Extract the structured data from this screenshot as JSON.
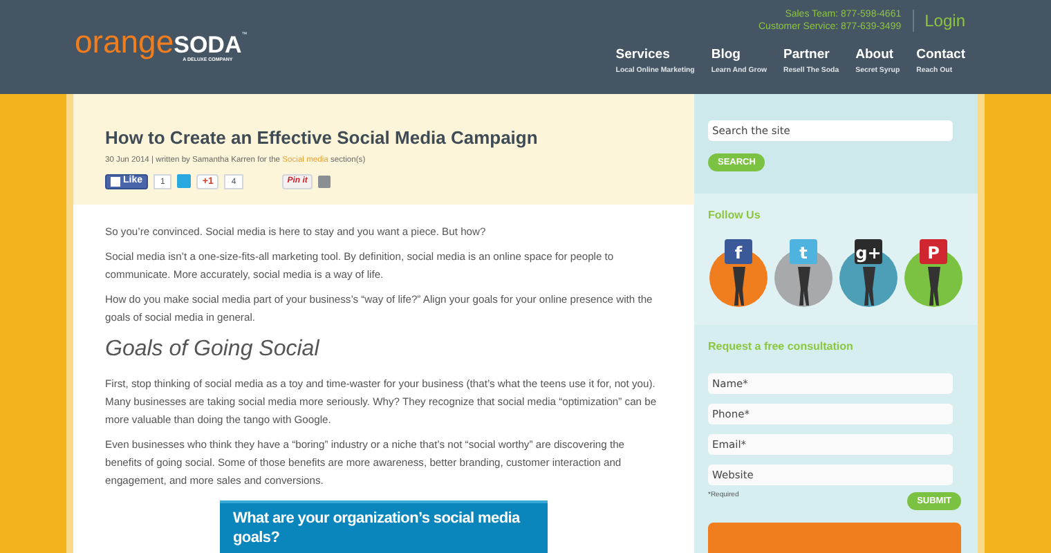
{
  "header": {
    "logo": {
      "word1": "orange",
      "word2": "SODA",
      "tm": "™",
      "tagline": "A DELUXE COMPANY"
    },
    "contacts": [
      "Sales Team: 877-598-4661",
      "Customer Service: 877-639-3499"
    ],
    "login": "Login",
    "nav": [
      {
        "label": "Services",
        "sub": "Local Online Marketing"
      },
      {
        "label": "Blog",
        "sub": "Learn And Grow"
      },
      {
        "label": "Partner",
        "sub": "Resell The Soda"
      },
      {
        "label": "About",
        "sub": "Secret Syrup"
      },
      {
        "label": "Contact",
        "sub": "Reach Out"
      }
    ]
  },
  "article": {
    "title": "How to Create an Effective Social Media Campaign",
    "meta": {
      "before": "30 Jun 2014 | written by Samantha Karren for the",
      "link": "Social media",
      "after": "section(s)"
    },
    "share": [
      {
        "kind": "facebook",
        "label": "Like",
        "count": "1"
      },
      {
        "kind": "twitter"
      },
      {
        "kind": "google",
        "label": "+1",
        "count": "4"
      },
      {
        "kind": "pinterest",
        "label": "Pin it"
      },
      {
        "kind": "email"
      }
    ],
    "blocks": [
      {
        "kind": "p",
        "text": "So you’re convinced. Social media is here to stay and you want a piece. But how?"
      },
      {
        "kind": "p",
        "text": "Social media isn’t a one-size-fits-all marketing tool. By definition, social media is an online space for people to communicate. More accurately, social media is a way of life."
      },
      {
        "kind": "p",
        "text": "How do you make social media part of your business’s “way of life?” Align your goals for your online presence with the goals of social media in general."
      },
      {
        "kind": "h2",
        "text": "Goals of Going Social"
      },
      {
        "kind": "p",
        "text": "First, stop thinking of social media as a toy and time-waster for your business (that’s what the teens use it for, not you). Many businesses are taking social media more seriously. Why? They recognize that social media “optimization” can be more valuable than doing the tango with Google."
      },
      {
        "kind": "p",
        "text": "Even businesses who think they have a “boring” industry or a niche that’s not “social worthy” are discovering the benefits of going social. Some of those benefits are more awareness, better branding, customer interaction and engagement, and more sales and conversions."
      },
      {
        "kind": "banner",
        "text": "What are your organization’s social media goals?"
      }
    ]
  },
  "sidebar": {
    "search": {
      "placeholder": "Search the site",
      "button": "SEARCH"
    },
    "follow": {
      "title": "Follow Us",
      "items": [
        {
          "kind": "facebook",
          "color": "#f07d1e",
          "letter": "f"
        },
        {
          "kind": "twitter",
          "color": "#a7a9ab",
          "letter": "t"
        },
        {
          "kind": "google",
          "color": "#4d9fb8",
          "letter": "g+"
        },
        {
          "kind": "pinterest",
          "color": "#7cc242",
          "letter": "P"
        }
      ]
    },
    "consult": {
      "title": "Request a free consultation",
      "fields": [
        {
          "placeholder": "Name*"
        },
        {
          "placeholder": "Phone*"
        },
        {
          "placeholder": "Email*"
        },
        {
          "placeholder": "Website"
        }
      ],
      "note": "*Required",
      "button": "SUBMIT"
    }
  }
}
